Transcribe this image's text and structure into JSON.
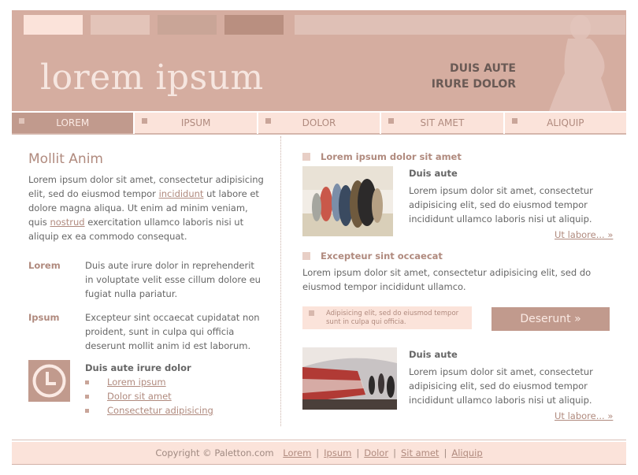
{
  "header": {
    "swatches": [
      "#fbe3da",
      "#e3c4b9",
      "#c9a597",
      "#b98f80"
    ],
    "logo": "lorem ipsum",
    "tagline_line1": "DUIS AUTE",
    "tagline_line2": "IRURE DOLOR"
  },
  "nav": {
    "items": [
      {
        "label": "LOREM",
        "active": true
      },
      {
        "label": "IPSUM",
        "active": false
      },
      {
        "label": "DOLOR",
        "active": false
      },
      {
        "label": "SIT AMET",
        "active": false
      },
      {
        "label": "ALIQUIP",
        "active": false
      }
    ]
  },
  "left": {
    "title": "Mollit Anim",
    "intro_part1": "Lorem ipsum dolor sit amet, consectetur adipisicing elit, sed do eiusmod tempor ",
    "intro_link1": "incididunt",
    "intro_part2": " ut labore et dolore magna aliqua. Ut enim ad minim veniam, quis ",
    "intro_link2": "nostrud",
    "intro_part3": " exercitation ullamco laboris nisi ut aliquip ex ea commodo consequat.",
    "def1_term": "Lorem",
    "def1_desc": "Duis aute irure dolor in reprehenderit in voluptate velit esse cillum dolore eu fugiat nulla pariatur.",
    "def2_term": "Ipsum",
    "def2_desc": "Excepteur sint occaecat cupidatat non proident, sunt in culpa qui officia deserunt mollit anim id est laborum.",
    "list_title": "Duis aute irure dolor",
    "list_links": [
      "Lorem ipsum",
      "Dolor sit amet",
      "Consectetur adipisicing"
    ]
  },
  "right": {
    "section1_title": "Lorem ipsum dolor sit amet",
    "article1_subtitle": "Duis aute",
    "article1_text": "Lorem ipsum dolor sit amet, consectetur adipisicing elit, sed do eiusmod tempor incididunt ullamco laboris nisi ut aliquip.",
    "article1_more": "Ut labore... »",
    "section2_title": "Excepteur sint occaecat",
    "section2_text": "Lorem ipsum dolor sit amet, consectetur adipisicing elit, sed do eiusmod tempor incididunt ullamco.",
    "note_text": "Adipisicing elit, sed do eiusmod tempor sunt in culpa qui officia.",
    "button_label": "Deserunt »",
    "article2_subtitle": "Duis aute",
    "article2_text": "Lorem ipsum dolor sit amet, consectetur adipisicing elit, sed do eiusmod tempor incididunt ullamco laboris nisi ut aliquip.",
    "article2_more": "Ut labore... »"
  },
  "footer": {
    "copyright": "Copyright © Paletton.com",
    "links": [
      "Lorem",
      "Ipsum",
      "Dolor",
      "Sit amet",
      "Aliquip"
    ]
  }
}
